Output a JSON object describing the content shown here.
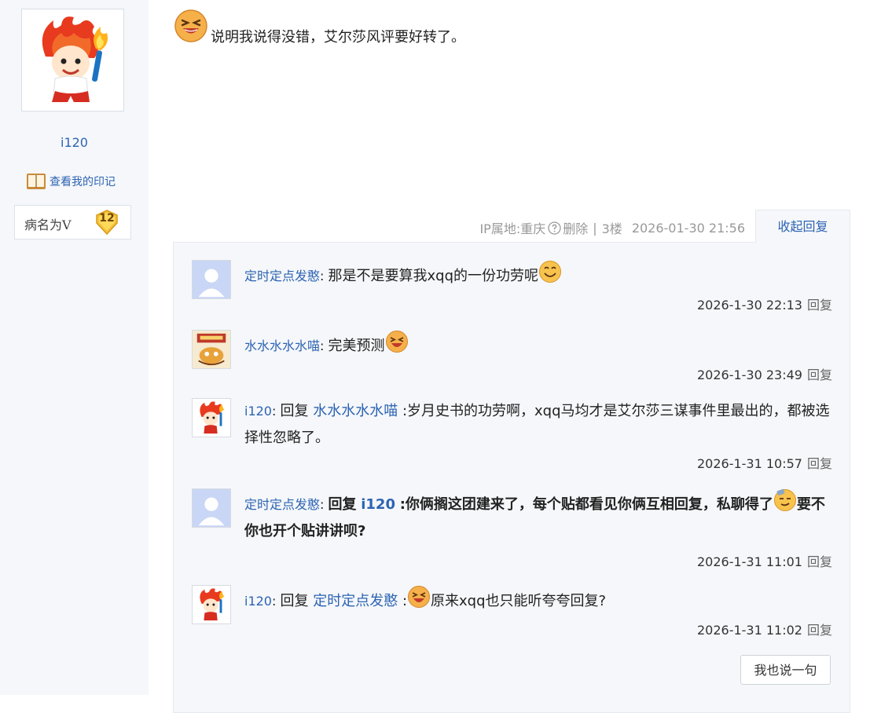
{
  "sidebar": {
    "username": "i120",
    "imprint_link": "查看我的印记",
    "level_name": "病名为V",
    "level_number": "12"
  },
  "post": {
    "text": "说明我说得没错，艾尔莎风评要好转了。",
    "ip_location": "IP属地:重庆",
    "delete_label": "删除",
    "separator": "|",
    "floor": "3楼",
    "timestamp": "2026-01-30 21:56",
    "collapse_label": "收起回复"
  },
  "comments": [
    {
      "user": "定时定点发憨",
      "text": "那是不是要算我xqq的一份功劳呢",
      "time": "2026-1-30 22:13",
      "reply_label": "回复"
    },
    {
      "user": "水水水水水喵",
      "text": "完美预测",
      "time": "2026-1-30 23:49",
      "reply_label": "回复"
    },
    {
      "user": "i120",
      "reply_word": "回复",
      "target": "水水水水水喵",
      "text": ":岁月史书的功劳啊，xqq马均才是艾尔莎三谋事件里最出的，都被选择性忽略了。",
      "time": "2026-1-31 10:57",
      "reply_label": "回复"
    },
    {
      "user": "定时定点发憨",
      "reply_word": "回复",
      "target": "i120",
      "text_a": ":你俩搁这团建来了，每个贴都看见你俩互相回复，私聊得了",
      "text_b": "要不你也开个贴讲讲呗?",
      "time": "2026-1-31 11:01",
      "reply_label": "回复"
    },
    {
      "user": "i120",
      "reply_word": "回复",
      "target": "定时定点发憨",
      "text_a": ":",
      "text_b": "原来xqq也只能听夸夸回复?",
      "time": "2026-1-31 11:02",
      "reply_label": "回复"
    }
  ],
  "say_button": "我也说一句"
}
